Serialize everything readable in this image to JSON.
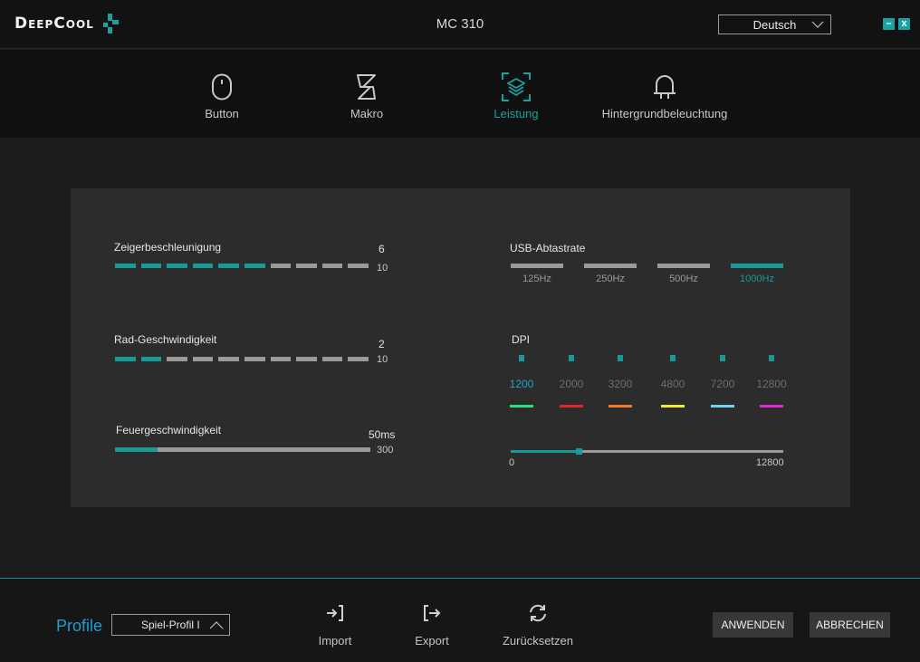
{
  "app": {
    "logo_text": "DeepCool",
    "window_title": "MC 310",
    "language": "Deutsch",
    "minimize_label": "–",
    "close_label": "x"
  },
  "nav": {
    "items": [
      {
        "label": "Button",
        "icon": "mouse-icon",
        "active": false
      },
      {
        "label": "Makro",
        "icon": "macro-icon",
        "active": false
      },
      {
        "label": "Leistung",
        "icon": "performance-layers-icon",
        "active": true
      },
      {
        "label": "Hintergrundbeleuchtung",
        "icon": "light-bulb-icon",
        "active": false
      }
    ]
  },
  "performance": {
    "pointer_accel": {
      "label": "Zeigerbeschleunigung",
      "value": "6",
      "max": "10",
      "level": 6,
      "segments": 10
    },
    "wheel_speed": {
      "label": "Rad-Geschwindigkeit",
      "value": "2",
      "max": "10",
      "level": 2,
      "segments": 10
    },
    "fire_speed": {
      "label": "Feuergeschwindigkeit",
      "value": "50ms",
      "max": "300",
      "fill_fraction": 0.167
    },
    "usb_rate": {
      "label": "USB-Abtastrate",
      "options": [
        "125Hz",
        "250Hz",
        "500Hz",
        "1000Hz"
      ],
      "selected": "1000Hz"
    },
    "dpi": {
      "label": "DPI",
      "levels": [
        {
          "value": "1200",
          "color": "#2ee07a",
          "active": true
        },
        {
          "value": "2000",
          "color": "#e0262a",
          "active": false
        },
        {
          "value": "3200",
          "color": "#f07a22",
          "active": false
        },
        {
          "value": "4800",
          "color": "#f2ea2a",
          "active": false
        },
        {
          "value": "7200",
          "color": "#6ad6f2",
          "active": false
        },
        {
          "value": "12800",
          "color": "#e02ad8",
          "active": false
        }
      ],
      "slider_min": "0",
      "slider_max": "12800",
      "slider_value": 3200
    }
  },
  "footer": {
    "profile_label": "Profile",
    "profile_value": "Spiel-Profil I",
    "import_label": "Import",
    "export_label": "Export",
    "reset_label": "Zurücksetzen",
    "apply_label": "ANWENDEN",
    "cancel_label": "ABBRECHEN"
  },
  "colors": {
    "accent": "#179a99",
    "profile_blue": "#1e9ed4",
    "dpi_active": "#1aa6c9"
  }
}
